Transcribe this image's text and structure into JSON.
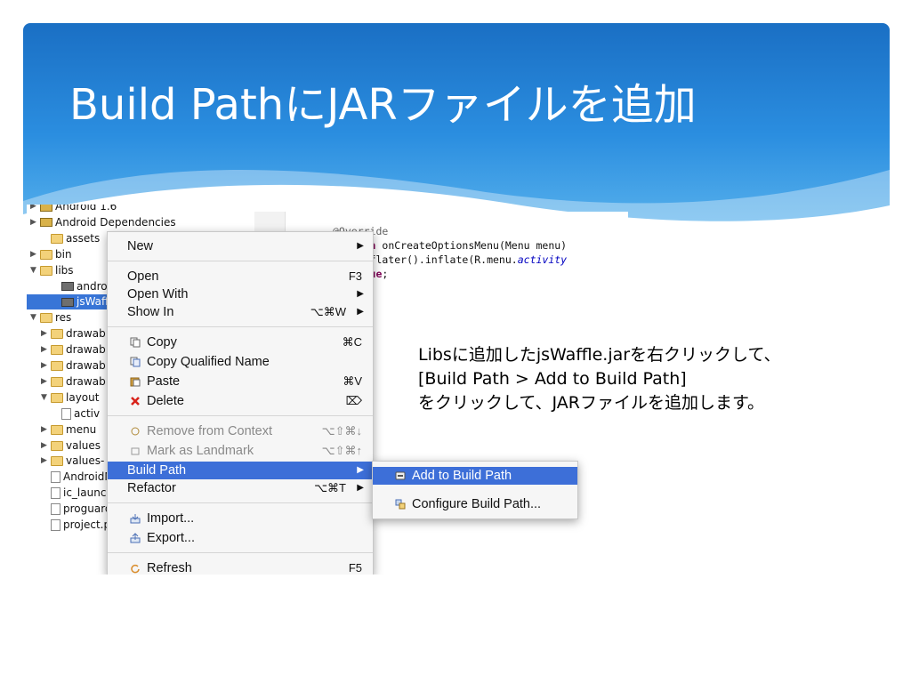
{
  "slide": {
    "title": "Build PathにJARファイルを追加",
    "note_lines": [
      "Libsに追加したjsWaffle.jarを右クリックして、",
      "[Build Path > Add to Build Path]",
      "をクリックして、JARファイルを追加します。"
    ],
    "colors": {
      "header_dark": "#1a6fc4",
      "header_light": "#57b1ec",
      "selection": "#3d6fd8"
    }
  },
  "tree": {
    "items": [
      {
        "label": "Android 1.6",
        "icon": "library-icon",
        "twisty": "▶"
      },
      {
        "label": "Android Dependencies",
        "icon": "library-icon",
        "twisty": "▶"
      },
      {
        "label": "assets",
        "icon": "folder-icon",
        "twisty": ""
      },
      {
        "label": "bin",
        "icon": "folder-icon",
        "twisty": "▶"
      },
      {
        "label": "libs",
        "icon": "folder-icon",
        "twisty": "▼"
      },
      {
        "label": "androi",
        "icon": "jar-icon",
        "twisty": ""
      },
      {
        "label": "jsWaffl",
        "icon": "jar-icon",
        "twisty": ""
      },
      {
        "label": "res",
        "icon": "folder-icon",
        "twisty": "▼"
      },
      {
        "label": "drawab",
        "icon": "folder-icon",
        "twisty": "▶"
      },
      {
        "label": "drawab",
        "icon": "folder-icon",
        "twisty": "▶"
      },
      {
        "label": "drawab",
        "icon": "folder-icon",
        "twisty": "▶"
      },
      {
        "label": "drawab",
        "icon": "folder-icon",
        "twisty": "▶"
      },
      {
        "label": "layout",
        "icon": "folder-icon",
        "twisty": "▼"
      },
      {
        "label": "activ",
        "icon": "file-icon",
        "twisty": ""
      },
      {
        "label": "menu",
        "icon": "folder-icon",
        "twisty": "▶"
      },
      {
        "label": "values",
        "icon": "folder-icon",
        "twisty": "▶"
      },
      {
        "label": "values-",
        "icon": "folder-icon",
        "twisty": "▶"
      },
      {
        "label": "AndroidM",
        "icon": "file-icon",
        "twisty": ""
      },
      {
        "label": "ic_launche",
        "icon": "image-icon",
        "twisty": ""
      },
      {
        "label": "proguard-",
        "icon": "file-icon",
        "twisty": ""
      },
      {
        "label": "project.pr",
        "icon": "file-icon",
        "twisty": ""
      }
    ],
    "selected_label": "jsWaffl"
  },
  "editor": {
    "line1": "@Override",
    "line2_kw": "boolean",
    "line2_rest": " onCreateOptionsMenu(Menu menu)",
    "line3_a": "MenuInflater().inflate(R.menu.",
    "line3_it": "activity",
    "line4_kw": "urn true",
    "line4_rest": ";"
  },
  "context_menu": {
    "new": {
      "label": "New",
      "arrow": "▶"
    },
    "open": {
      "label": "Open",
      "shortcut": "F3"
    },
    "open_with": {
      "label": "Open With",
      "arrow": "▶"
    },
    "show_in": {
      "label": "Show In",
      "shortcut": "⌥⌘W",
      "arrow": "▶"
    },
    "copy": {
      "label": "Copy",
      "shortcut": "⌘C"
    },
    "copy_qualified": {
      "label": "Copy Qualified Name"
    },
    "paste": {
      "label": "Paste",
      "shortcut": "⌘V"
    },
    "delete": {
      "label": "Delete",
      "shortcut": "⌦"
    },
    "remove_context": {
      "label": "Remove from Context",
      "shortcut": "⌥⇧⌘↓"
    },
    "mark_landmark": {
      "label": "Mark as Landmark",
      "shortcut": "⌥⇧⌘↑"
    },
    "build_path": {
      "label": "Build Path",
      "arrow": "▶"
    },
    "refactor": {
      "label": "Refactor",
      "shortcut": "⌥⌘T",
      "arrow": "▶"
    },
    "import": {
      "label": "Import..."
    },
    "export": {
      "label": "Export..."
    },
    "refresh": {
      "label": "Refresh",
      "shortcut": "F5"
    }
  },
  "submenu": {
    "add_to_build_path": {
      "label": "Add to Build Path"
    },
    "configure_build_path": {
      "label": "Configure Build Path..."
    }
  }
}
